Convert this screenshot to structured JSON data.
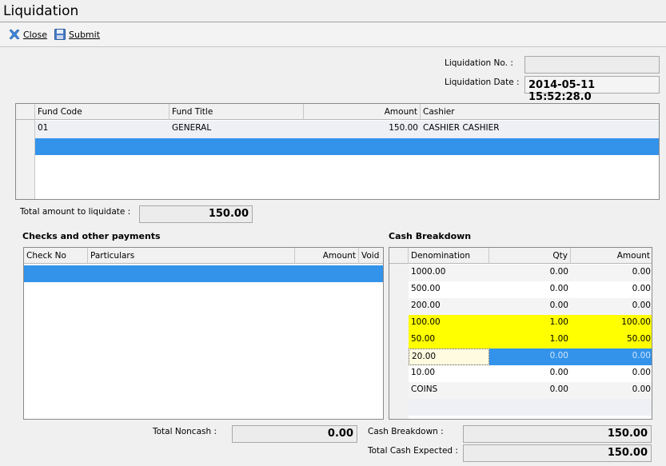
{
  "window": {
    "title": "Liquidation"
  },
  "toolbar": {
    "close_label": "Close",
    "submit_label": "Submit"
  },
  "header": {
    "liq_no_label": "Liquidation No. :",
    "liq_no_value": "",
    "liq_date_label": "Liquidation Date :",
    "liq_date_value": "2014-05-11 15:52:28.0"
  },
  "fund_table": {
    "columns": [
      "Fund Code",
      "Fund Title",
      "Amount",
      "Cashier"
    ],
    "rows": [
      {
        "code": "01",
        "title": "GENERAL",
        "amount": "150.00",
        "cashier": "CASHIER CASHIER"
      }
    ]
  },
  "total_liquidate": {
    "label": "Total amount to liquidate :",
    "value": "150.00"
  },
  "checks": {
    "section_title": "Checks and other payments",
    "columns": [
      "Check No",
      "Particulars",
      "Amount",
      "Void"
    ]
  },
  "cash": {
    "section_title": "Cash Breakdown",
    "columns": [
      "Denomination",
      "Qty",
      "Amount"
    ],
    "rows": [
      {
        "denom": "1000.00",
        "qty": "0.00",
        "amount": "0.00"
      },
      {
        "denom": "500.00",
        "qty": "0.00",
        "amount": "0.00"
      },
      {
        "denom": "200.00",
        "qty": "0.00",
        "amount": "0.00"
      },
      {
        "denom": "100.00",
        "qty": "1.00",
        "amount": "100.00"
      },
      {
        "denom": "50.00",
        "qty": "1.00",
        "amount": "50.00"
      },
      {
        "denom": "20.00",
        "qty": "0.00",
        "amount": "0.00"
      },
      {
        "denom": "10.00",
        "qty": "0.00",
        "amount": "0.00"
      },
      {
        "denom": "COINS",
        "qty": "0.00",
        "amount": "0.00"
      }
    ]
  },
  "totals": {
    "noncash_label": "Total Noncash :",
    "noncash_value": "0.00",
    "cash_breakdown_label": "Cash Breakdown :",
    "cash_breakdown_value": "150.00",
    "cash_expected_label": "Total Cash Expected :",
    "cash_expected_value": "150.00"
  },
  "colors": {
    "selection": "#3393ea",
    "highlight": "#ffff00"
  }
}
